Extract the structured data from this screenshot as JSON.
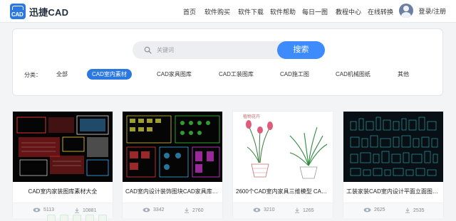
{
  "header": {
    "logo_mark_text": "CAD",
    "logo_name": "迅捷CAD",
    "nav": [
      "首页",
      "软件购买",
      "软件下载",
      "软件帮助",
      "每日一图",
      "教程中心",
      "在线转换"
    ],
    "login": "登录/注册"
  },
  "search": {
    "placeholder": "关键词",
    "button": "搜索"
  },
  "categories": {
    "label": "分类：",
    "items": [
      "全部",
      "CAD室内素材",
      "CAD家具图库",
      "CAD工装图库",
      "CAD施工图",
      "CAD机械图纸",
      "其他"
    ],
    "active": "CAD室内素材"
  },
  "cards": [
    {
      "title": "CAD室内家装图库素材大全",
      "views": "5113",
      "downloads": "10881"
    },
    {
      "title": "CAD室内设计装饰图块CAD家具库图块",
      "views": "3342",
      "downloads": "2760"
    },
    {
      "title": "2600个CAD室内家具三维模型 CAD室内...",
      "views": "3210",
      "downloads": "1265"
    },
    {
      "title": "工装家装CAD室内设计平面立面图块素材",
      "views": "2625",
      "downloads": "2535"
    }
  ],
  "colors": {
    "accent": "#2a78e0",
    "search_button": "#3d8bfd"
  },
  "icons": {
    "search": "search-icon",
    "views": "eye-icon",
    "downloads": "download-icon",
    "user": "avatar-icon"
  }
}
